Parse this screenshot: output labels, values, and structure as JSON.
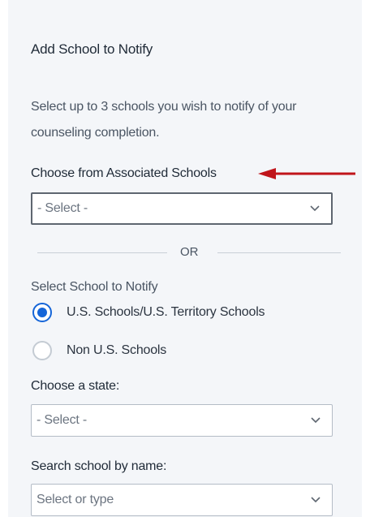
{
  "section": {
    "title": "Add School to Notify",
    "description": "Select up to 3 schools you wish to notify of your counseling completion."
  },
  "associated": {
    "label": "Choose from Associated Schools",
    "select_value": "- Select -"
  },
  "divider": {
    "text": "OR"
  },
  "notify": {
    "label": "Select School to Notify",
    "options": [
      {
        "label": "U.S. Schools/U.S. Territory Schools",
        "checked": true
      },
      {
        "label": "Non U.S. Schools",
        "checked": false
      }
    ]
  },
  "state": {
    "label": "Choose a state:",
    "select_value": "- Select -"
  },
  "search": {
    "label": "Search school by name:",
    "placeholder": "Select or type"
  },
  "colors": {
    "accent": "#1565d8",
    "annotation_arrow": "#c0151b",
    "panel_bg": "#f4f6f9"
  }
}
